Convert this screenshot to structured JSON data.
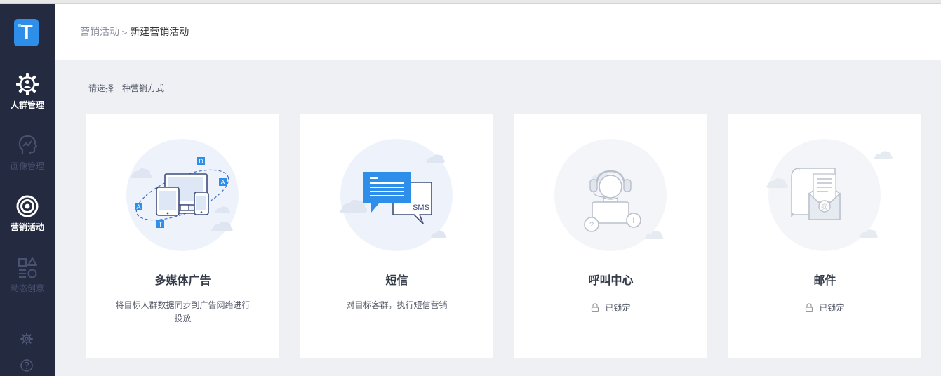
{
  "app": {
    "logo_letter": "T"
  },
  "sidebar": {
    "items": [
      {
        "label": "人群管理",
        "icon": "crowd-gear-icon",
        "state": "active"
      },
      {
        "label": "画像管理",
        "icon": "portrait-head-icon",
        "state": "dim"
      },
      {
        "label": "营销活动",
        "icon": "target-icon",
        "state": "active"
      },
      {
        "label": "动态创意",
        "icon": "shapes-icon",
        "state": "dim"
      }
    ],
    "bottom": [
      {
        "icon": "settings-icon"
      },
      {
        "icon": "help-icon"
      }
    ]
  },
  "header": {
    "breadcrumb": {
      "parent": "营销活动",
      "separator": ">",
      "current": "新建营销活动"
    }
  },
  "main": {
    "prompt": "请选择一种营销方式",
    "cards": [
      {
        "title": "多媒体广告",
        "description": "将目标人群数据同步到广告网络进行投放",
        "locked": false,
        "illustration": "multimedia-devices-icon",
        "badges": [
          "D",
          "A",
          "A",
          "T"
        ]
      },
      {
        "title": "短信",
        "description": "对目标客群，执行短信营销",
        "locked": false,
        "illustration": "sms-bubbles-icon",
        "bubble_text": "SMS"
      },
      {
        "title": "呼叫中心",
        "locked": true,
        "status": "已锁定",
        "illustration": "call-center-agent-icon"
      },
      {
        "title": "邮件",
        "locked": true,
        "status": "已锁定",
        "illustration": "mail-envelope-icon"
      }
    ]
  },
  "colors": {
    "sidebar_bg": "#242a40",
    "accent": "#2e8fea",
    "page_bg": "#eef0f4",
    "card_bg": "#ffffff",
    "dim_nav": "#4a5272"
  }
}
